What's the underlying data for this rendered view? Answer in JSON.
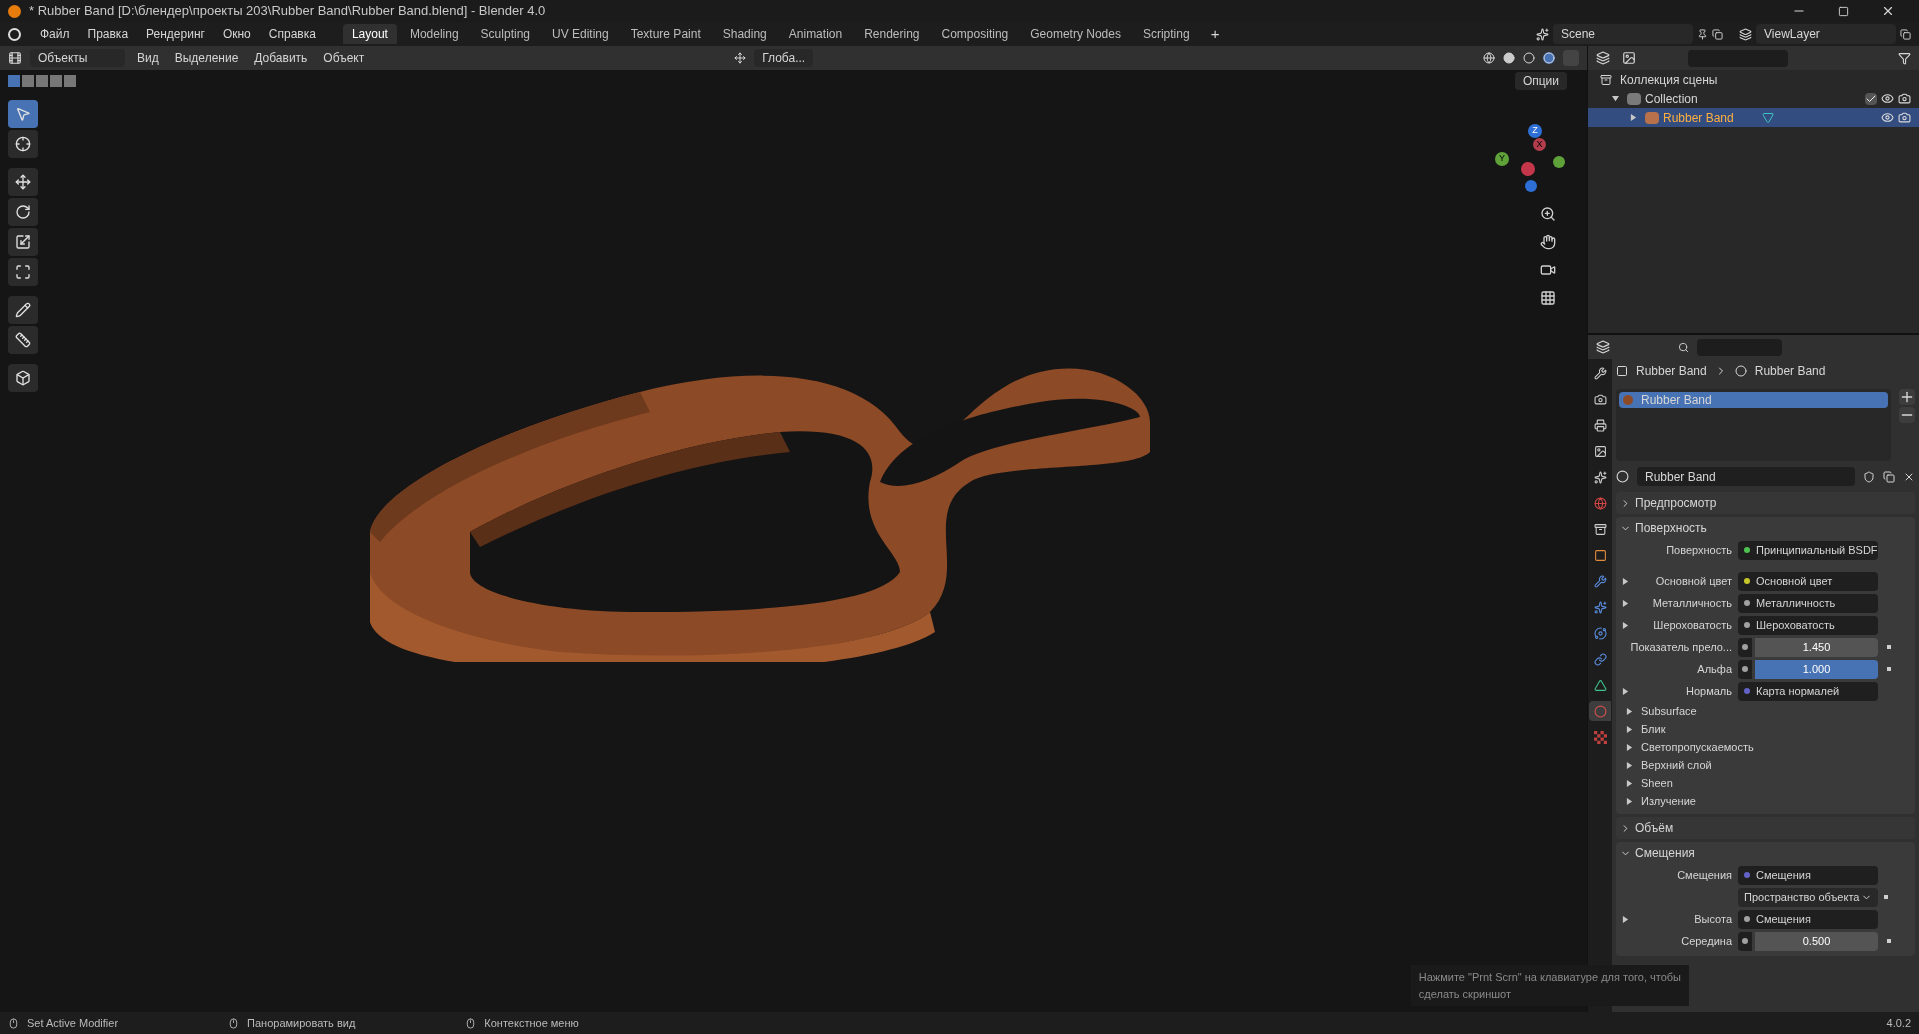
{
  "window": {
    "title": "* Rubber Band [D:\\блендер\\проекты 203\\Rubber Band\\Rubber Band.blend] - Blender 4.0"
  },
  "menu": [
    "Файл",
    "Правка",
    "Рендеринг",
    "Окно",
    "Справка"
  ],
  "workspaces": [
    {
      "label": "Layout",
      "selected": true
    },
    {
      "label": "Modeling",
      "selected": false
    },
    {
      "label": "Sculpting",
      "selected": false
    },
    {
      "label": "UV Editing",
      "selected": false
    },
    {
      "label": "Texture Paint",
      "selected": false
    },
    {
      "label": "Shading",
      "selected": false
    },
    {
      "label": "Animation",
      "selected": false
    },
    {
      "label": "Rendering",
      "selected": false
    },
    {
      "label": "Compositing",
      "selected": false
    },
    {
      "label": "Geometry Nodes",
      "selected": false
    },
    {
      "label": "Scripting",
      "selected": false
    }
  ],
  "add_workspace": "+",
  "scene": "Scene",
  "view_layer": "ViewLayer",
  "viewport": {
    "mode": "Объекты",
    "menus": [
      "Вид",
      "Выделение",
      "Добавить",
      "Объект"
    ],
    "orientation": "Глоба...",
    "options": "Опции",
    "tools": [
      {
        "kind": "select",
        "selected": true
      },
      {
        "kind": "cursor",
        "selected": false
      },
      {
        "kind": "move",
        "selected": false
      },
      {
        "kind": "rotate",
        "selected": false
      },
      {
        "kind": "scale",
        "selected": false
      },
      {
        "kind": "transform",
        "selected": false
      },
      {
        "kind": "annotate",
        "selected": false
      },
      {
        "kind": "measure",
        "selected": false
      },
      {
        "kind": "add-cube",
        "selected": false
      }
    ],
    "gizmo": {
      "x": "X",
      "y": "Y",
      "z": "Z"
    }
  },
  "outliner": {
    "root": "Коллекция сцены",
    "children": [
      {
        "name": "Collection",
        "expanded": true,
        "selected": false,
        "children": [
          {
            "name": "Rubber Band",
            "expanded": false,
            "selected": true
          }
        ]
      }
    ]
  },
  "properties": {
    "tabs": [
      {
        "kind": "tool",
        "selected": false
      },
      {
        "kind": "render",
        "selected": false
      },
      {
        "kind": "output",
        "selected": false
      },
      {
        "kind": "view-layer",
        "selected": false
      },
      {
        "kind": "scene",
        "selected": false
      },
      {
        "kind": "world",
        "selected": false
      },
      {
        "kind": "collection",
        "selected": false
      },
      {
        "kind": "object",
        "selected": false
      },
      {
        "kind": "modifier",
        "selected": false
      },
      {
        "kind": "particles",
        "selected": false
      },
      {
        "kind": "physics",
        "selected": false
      },
      {
        "kind": "constraints",
        "selected": false
      },
      {
        "kind": "data",
        "selected": false
      },
      {
        "kind": "material",
        "selected": true
      },
      {
        "kind": "texture",
        "selected": false
      }
    ],
    "breadcrumb": [
      "Rubber Band",
      "Rubber Band"
    ],
    "slots": [
      {
        "name": "Rubber Band",
        "selected": true
      }
    ],
    "material": "Rubber Band",
    "panels": [
      {
        "title": "Предпросмотр",
        "expanded": false
      },
      {
        "title": "Поверхность",
        "expanded": true,
        "rows": [
          {
            "kind": "socket",
            "label": "Поверхность",
            "value": "Принципиальный BSDF",
            "color": "#4ec24e",
            "expandable": false
          },
          {
            "kind": "gap"
          },
          {
            "kind": "socket",
            "label": "Основной цвет",
            "value": "Основной цвет",
            "color": "#c7c729",
            "expandable": true
          },
          {
            "kind": "socket",
            "label": "Металличность",
            "value": "Металличность",
            "color": "#a1a1a1",
            "expandable": true
          },
          {
            "kind": "socket",
            "label": "Шероховатость",
            "value": "Шероховатость",
            "color": "#a1a1a1",
            "expandable": true
          },
          {
            "kind": "number",
            "label": "Показатель прело...",
            "value": "1.450",
            "color": "#a1a1a1"
          },
          {
            "kind": "slider",
            "label": "Альфа",
            "value": "1.000",
            "color": "#a1a1a1",
            "level": 1
          },
          {
            "kind": "socket",
            "label": "Нормаль",
            "value": "Карта нормалей",
            "color": "#6363c7",
            "expandable": true
          },
          {
            "kind": "sub",
            "label": "Subsurface"
          },
          {
            "kind": "sub",
            "label": "Блик"
          },
          {
            "kind": "sub",
            "label": "Светопропускаемость"
          },
          {
            "kind": "sub",
            "label": "Верхний слой"
          },
          {
            "kind": "sub",
            "label": "Sheen"
          },
          {
            "kind": "sub",
            "label": "Излучение"
          }
        ]
      },
      {
        "title": "Объём",
        "expanded": false
      },
      {
        "title": "Смещения",
        "expanded": true,
        "rows": [
          {
            "kind": "socket",
            "label": "Смещения",
            "value": "Смещения",
            "color": "#6363c7",
            "expandable": false
          },
          {
            "kind": "dropdown",
            "value": "Пространство объекта"
          },
          {
            "kind": "socket",
            "label": "Высота",
            "value": "Смещения",
            "color": "#a1a1a1",
            "expandable": true
          },
          {
            "kind": "number",
            "label": "Середина",
            "value": "0.500",
            "color": "#a1a1a1"
          }
        ]
      }
    ]
  },
  "notification": [
    "Нажмите \"Prnt Scrn\" на клавиатуре для того, чтобы",
    "сделать скриншот"
  ],
  "status_bar": {
    "hints": [
      "Set Active Modifier",
      "Панорамировать вид",
      "Контекстное меню"
    ],
    "version": "4.0.2"
  }
}
